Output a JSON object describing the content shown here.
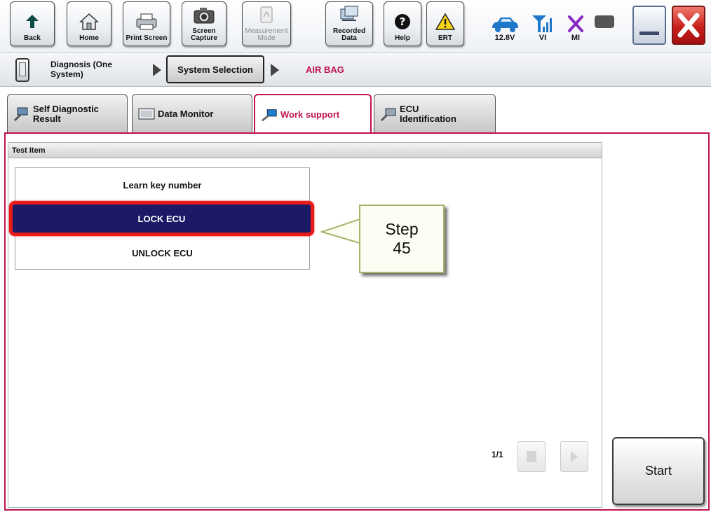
{
  "toolbar": {
    "buttons": [
      {
        "label": "Back",
        "icon": "back-arrow-icon"
      },
      {
        "label": "Home",
        "icon": "home-icon"
      },
      {
        "label": "Print Screen",
        "icon": "printer-icon"
      },
      {
        "label": "Screen\nCapture",
        "icon": "camera-icon"
      },
      {
        "label": "Measurement\nMode",
        "icon": "measurement-icon",
        "enabled": false
      },
      {
        "label": "Recorded\nData",
        "icon": "recorded-data-icon"
      },
      {
        "label": "Help",
        "icon": "help-icon"
      },
      {
        "label": "ERT",
        "icon": "warning-triangle-icon"
      }
    ],
    "status": {
      "battery_label": "12.8V",
      "vi_label": "VI",
      "mi_label": "MI"
    }
  },
  "breadcrumb": {
    "diagnosis_label": "Diagnosis (One\nSystem)",
    "system_selection_label": "System Selection",
    "current_label": "AIR BAG"
  },
  "tabs": [
    {
      "label": "Self Diagnostic\nResult",
      "icon": "self-diagnostic-icon"
    },
    {
      "label": "Data Monitor",
      "icon": "data-monitor-icon"
    },
    {
      "label": "Work support",
      "icon": "work-support-icon",
      "active": true
    },
    {
      "label": "ECU\nIdentification",
      "icon": "ecu-identification-icon"
    }
  ],
  "work_support": {
    "header": "Test Item",
    "items": [
      "Learn key number",
      "LOCK ECU",
      "UNLOCK ECU"
    ],
    "selected_item": "LOCK ECU",
    "page_indicator": "1/1",
    "start_label": "Start"
  },
  "callout": {
    "text": "Step\n45"
  },
  "colors": {
    "accent": "#c0144d",
    "selected_row": "#1c1a66",
    "highlight_border": "#e81a1a"
  }
}
